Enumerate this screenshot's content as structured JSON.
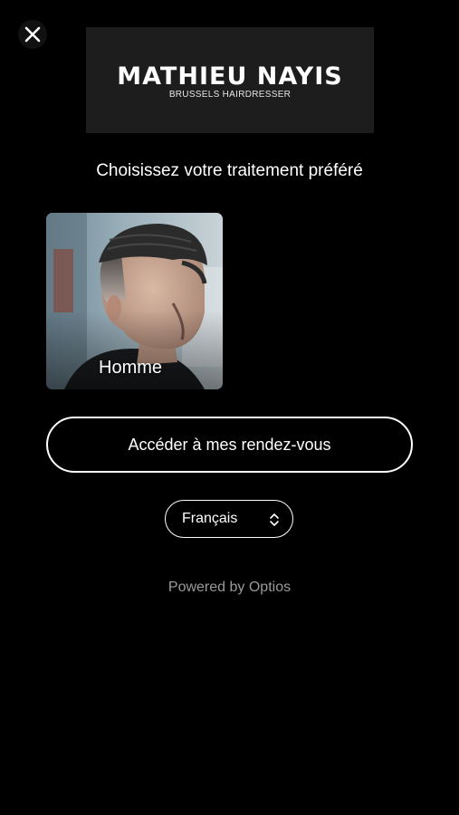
{
  "header": {
    "close_icon": "close-icon",
    "logo_title": "MATHIEU NAYIS",
    "logo_subtitle": "BRUSSELS HAIRDRESSER"
  },
  "main": {
    "heading": "Choisissez votre traitement préféré",
    "services": [
      {
        "label": "Homme",
        "image": "man-haircut-photo"
      }
    ],
    "appointments_button": "Accéder à mes rendez-vous",
    "language": {
      "selected": "Français",
      "icon": "chevron-up-down-icon"
    },
    "powered_by": "Powered by Optios"
  },
  "colors": {
    "background": "#000000",
    "logo_background": "#1d1d1d",
    "text": "#ffffff",
    "muted_text": "#9a9a9a"
  }
}
